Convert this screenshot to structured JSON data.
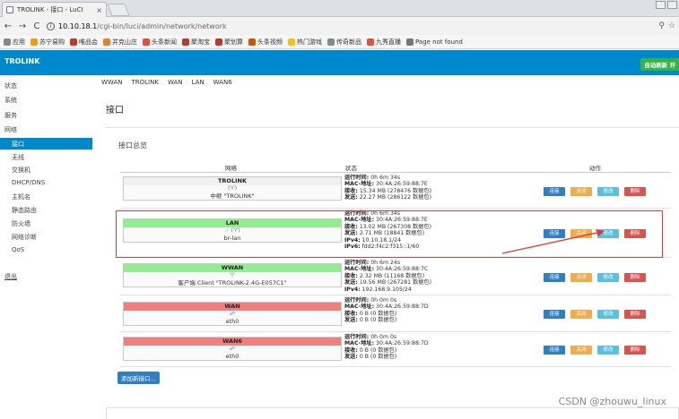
{
  "browser": {
    "tab_title": "TROLINK - 接口 - LuCI",
    "tab_close": "×",
    "url_host": "10.10.18.1",
    "url_path": "/cgi-bin/luci/admin/network/network",
    "bookmarks": [
      "应用",
      "苏宁易购",
      "唯品会",
      "并克山庄",
      "头条新闻",
      "聚淘宝",
      "聚划算",
      "头条视频",
      "热门游戏",
      "传奇新品",
      "九秀直播",
      "Page not found"
    ]
  },
  "header": {
    "brand": "TROLINK",
    "refresh_label": "自动刷新 开"
  },
  "sidebar": {
    "items": [
      "状态",
      "系统",
      "服务",
      "网络"
    ],
    "network_sub": [
      "接口",
      "无线",
      "交换机",
      "DHCP/DNS",
      "主机名",
      "静态路由",
      "防火墙",
      "网络诊断",
      "QoS"
    ],
    "logout": "退出"
  },
  "top_tabs": [
    "WWAN",
    "TROLINK",
    "WAN",
    "LAN",
    "WAN6"
  ],
  "page": {
    "title": "接口",
    "section_title": "接口总览",
    "col_network": "网络",
    "col_status": "状态",
    "col_action": "动作",
    "add_button": "添加新接口..."
  },
  "buttons": {
    "connect": "连接",
    "stop": "关闭",
    "edit": "修改",
    "delete": "删除"
  },
  "interfaces": [
    {
      "name": "TROLINK",
      "header_color": "#f0f0f0",
      "icon": "(♈)",
      "desc": "中继 \"TROLINK\"",
      "status": [
        [
          "运行时间:",
          "0h 6m 34s"
        ],
        [
          "MAC-地址:",
          "30:4A:26:59:88:7E"
        ],
        [
          "接收:",
          "15.34 MB (278476 数据包)"
        ],
        [
          "发送:",
          "22.27 MB (286122 数据包)"
        ]
      ]
    },
    {
      "name": "LAN",
      "header_color": "#90ee90",
      "icon": "☞ (♈)",
      "desc": "br-lan",
      "status": [
        [
          "运行时间:",
          "0h 6m 34s"
        ],
        [
          "MAC-地址:",
          "30:4A:26:59:88:7E"
        ],
        [
          "接收:",
          "13.02 MB (267308 数据包)"
        ],
        [
          "发送:",
          "2.71 MB (18841 数据包)"
        ],
        [
          "IPv4:",
          "10.10.18.1/24"
        ],
        [
          "IPv6:",
          "fdd2:f4c2:f315::1/60"
        ]
      ]
    },
    {
      "name": "WWAN",
      "header_color": "#90ee90",
      "icon": "♈",
      "desc": "客户端 Client \"TROLINK-2.4G-E057C1\"",
      "status": [
        [
          "运行时间:",
          "0h 6m 24s"
        ],
        [
          "MAC-地址:",
          "30:4A:26:59:88:7C"
        ],
        [
          "接收:",
          "2.32 MB (11168 数据包)"
        ],
        [
          "发送:",
          "19.56 MB (267281 数据包)"
        ],
        [
          "IPv4:",
          "192.168.9.105/24"
        ]
      ]
    },
    {
      "name": "WAN",
      "header_color": "#f08080",
      "icon": "☍",
      "desc": "eth0",
      "status": [
        [
          "运行时间:",
          "0h 0m 0s"
        ],
        [
          "MAC-地址:",
          "30:4A:26:59:88:7D"
        ],
        [
          "接收:",
          "0 B (0 数据包)"
        ],
        [
          "发送:",
          "0 B (0 数据包)"
        ]
      ]
    },
    {
      "name": "WAN6",
      "header_color": "#f08080",
      "icon": "☍",
      "desc": "eth0",
      "status": [
        [
          "运行时间:",
          "0h 0m 0s"
        ],
        [
          "MAC-地址:",
          "30:4A:26:59:88:7D"
        ],
        [
          "接收:",
          "0 B (0 数据包)"
        ],
        [
          "发送:",
          "0 B (0 数据包)"
        ]
      ]
    }
  ],
  "watermark": "CSDN @zhouwu_linux"
}
